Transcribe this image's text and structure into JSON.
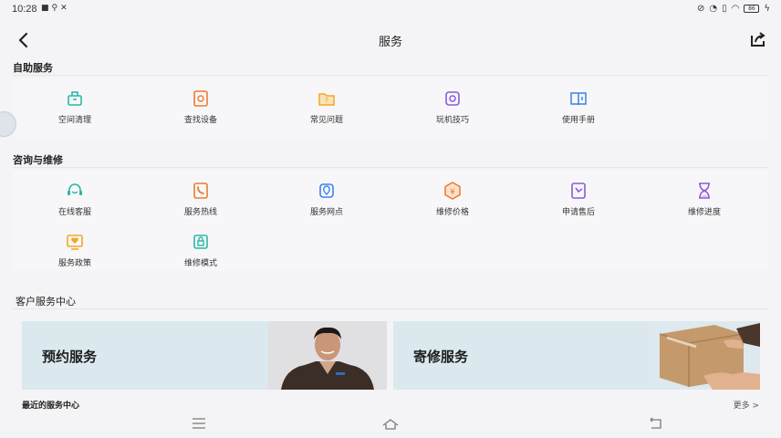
{
  "status_bar": {
    "time": "10:28",
    "left_icons": [
      "video-icon",
      "usb-icon",
      "tools-icon"
    ],
    "right_icons": [
      "mute-icon",
      "alarm-icon",
      "sim-icon",
      "wifi-icon"
    ],
    "battery": "86"
  },
  "header": {
    "title": "服务",
    "back_icon": "chevron-left-icon",
    "share_icon": "share-icon"
  },
  "self_service": {
    "title": "自助服务",
    "items": [
      {
        "label": "空间清理",
        "icon": "broom-icon",
        "color": "#2bb7a5"
      },
      {
        "label": "查找设备",
        "icon": "find-device-icon",
        "color": "#f0792d"
      },
      {
        "label": "常见问题",
        "icon": "question-folder-icon",
        "color": "#f5a623"
      },
      {
        "label": "玩机技巧",
        "icon": "tips-icon",
        "color": "#8c5bd6"
      },
      {
        "label": "使用手册",
        "icon": "manual-icon",
        "color": "#3b84e6"
      }
    ]
  },
  "repair": {
    "title": "咨询与维修",
    "items": [
      {
        "label": "在线客服",
        "icon": "headset-icon",
        "color": "#2bb7a5"
      },
      {
        "label": "服务热线",
        "icon": "phone-icon",
        "color": "#f0792d"
      },
      {
        "label": "服务网点",
        "icon": "location-icon",
        "color": "#3b84e6"
      },
      {
        "label": "维修价格",
        "icon": "price-icon",
        "color": "#f0792d"
      },
      {
        "label": "申请售后",
        "icon": "after-sales-icon",
        "color": "#8c5bd6"
      },
      {
        "label": "维修进度",
        "icon": "hourglass-icon",
        "color": "#8c5bd6"
      },
      {
        "label": "服务政策",
        "icon": "policy-icon",
        "color": "#f5a623"
      },
      {
        "label": "维修模式",
        "icon": "repair-mode-icon",
        "color": "#2bb7a5"
      }
    ]
  },
  "service_center": {
    "title": "客户服务中心",
    "cards": [
      {
        "label": "预约服务",
        "image": "person-photo"
      },
      {
        "label": "寄修服务",
        "image": "package-photo"
      }
    ],
    "recent_label": "最近的服务中心",
    "more_label": "更多 >"
  },
  "nav_bar": {
    "icons": [
      "menu-icon",
      "home-icon",
      "back-icon"
    ]
  }
}
